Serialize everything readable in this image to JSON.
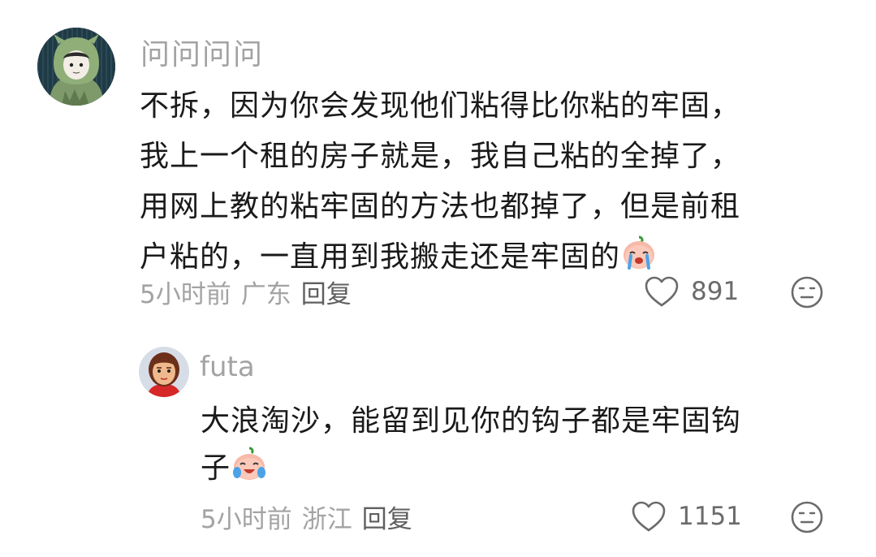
{
  "comments": [
    {
      "username": "问问问问",
      "avatar_icon": "cartoon-dragon-avatar",
      "text_lines": [
        "不拆，因为你会发现他们粘得比你粘的牢固，",
        "我上一个租的房子就是，我自己粘的全掉了，",
        "用网上教的粘牢固的方法也都掉了，但是前租",
        "户粘的，一直用到我搬走还是牢固的"
      ],
      "emoji": "crying-face-emoji",
      "time": "5小时前",
      "location": "广东",
      "reply_label": "回复",
      "like_count": "891"
    }
  ],
  "replies": [
    {
      "username": "futa",
      "avatar_icon": "cartoon-girl-avatar",
      "text_lines": [
        "大浪淘沙，能留到见你的钩子都是牢固钩",
        "子"
      ],
      "emoji": "laugh-cry-emoji",
      "time": "5小时前",
      "location": "浙江",
      "reply_label": "回复",
      "like_count": "1151"
    }
  ],
  "colors": {
    "secondary_text": "#a3a3a3",
    "primary_text": "#1a1a1a",
    "icon": "#6b6b6b"
  }
}
